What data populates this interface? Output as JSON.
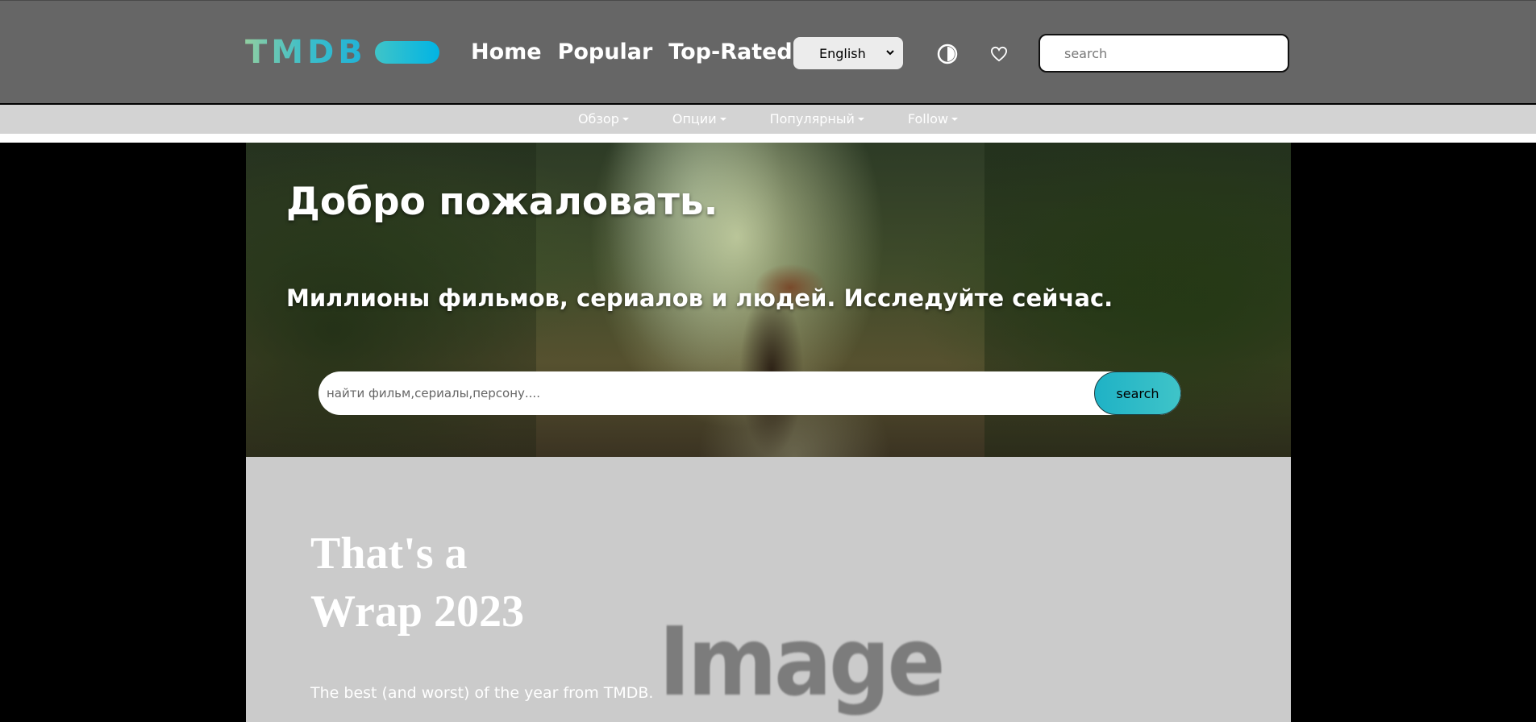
{
  "header": {
    "logo_text": "TMDB",
    "nav": [
      "Home",
      "Popular",
      "Top-Rated"
    ],
    "language": "English",
    "search_placeholder": "search"
  },
  "subnav": {
    "items": [
      "Обзор",
      "Опции",
      "Популярный",
      "Follow"
    ]
  },
  "hero": {
    "title": "Добро пожаловать.",
    "subtitle": "Миллионы фильмов, сериалов и людей. Исследуйте сейчас.",
    "search_placeholder": "найти фильм,сериалы,персону....",
    "search_button": "search"
  },
  "wrap": {
    "title": "That's a Wrap 2023",
    "placeholder_image_text": "Image",
    "description": "The best (and worst) of the year from TMDB."
  },
  "icons": {
    "theme": "contrast-icon",
    "favorites": "heart-icon"
  },
  "colors": {
    "header_bg": "#666666",
    "subnav_bg": "#d3d3d3",
    "accent_gradient_start": "#90cea1",
    "accent_gradient_end": "#01b4e4",
    "wrap_bg": "#cbcbcb"
  }
}
